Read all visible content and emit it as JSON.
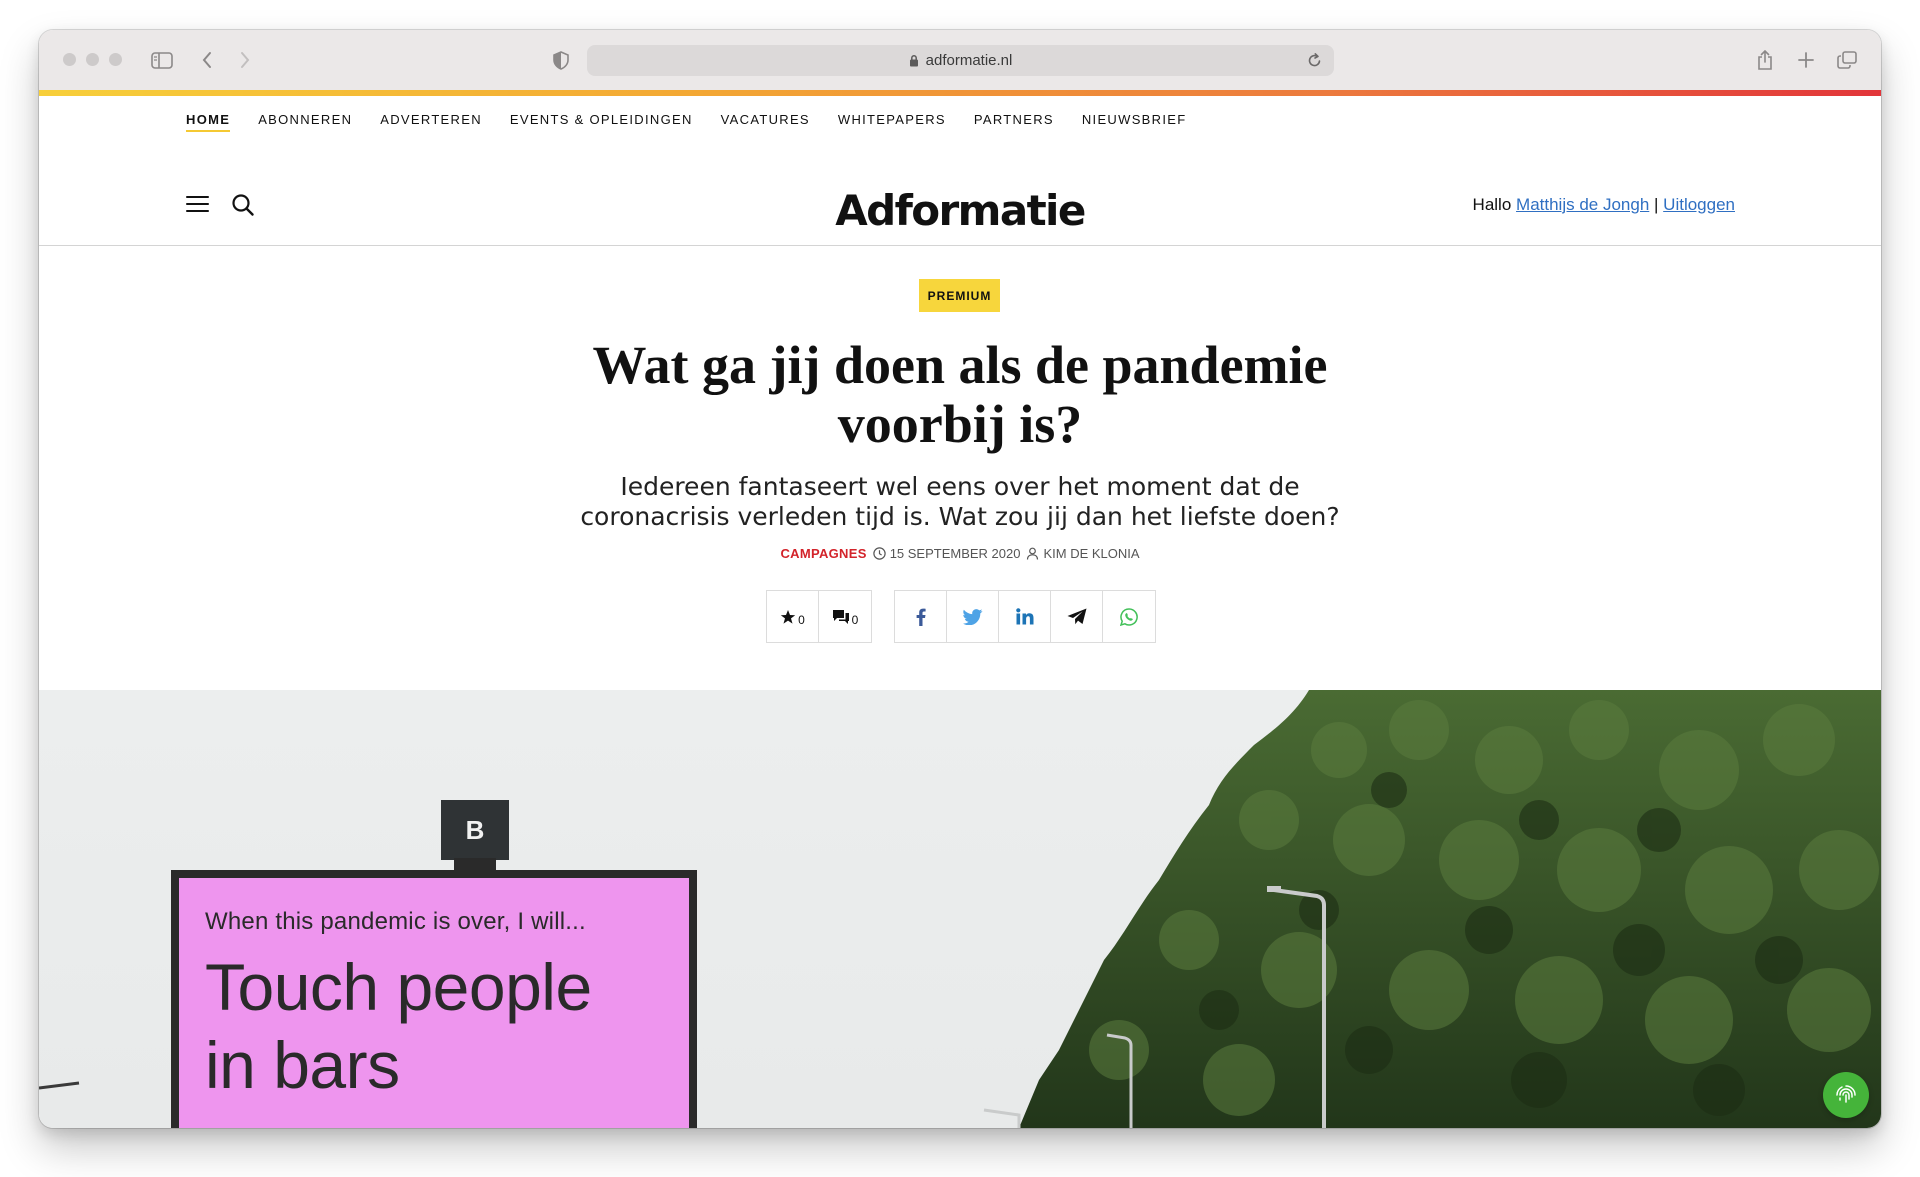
{
  "browser": {
    "url": "adformatie.nl"
  },
  "nav": {
    "items": [
      "HOME",
      "ABONNEREN",
      "ADVERTEREN",
      "EVENTS & OPLEIDINGEN",
      "VACATURES",
      "WHITEPAPERS",
      "PARTNERS",
      "NIEUWSBRIEF"
    ]
  },
  "header": {
    "logo": "Adformatie",
    "greeting": "Hallo",
    "user_name": "Matthijs de Jongh",
    "separator": "|",
    "logout": "Uitloggen"
  },
  "article": {
    "badge": "PREMIUM",
    "title_line1": "Wat ga jij doen als de pandemie",
    "title_line2": "voorbij is?",
    "intro_line1": "Iedereen fantaseert wel eens over het moment dat de",
    "intro_line2": "coronacrisis verleden tijd is. Wat zou jij dan het liefste doen?",
    "category": "CAMPAGNES",
    "date": "15 SEPTEMBER 2020",
    "author": "KIM DE KLONIA",
    "likes": "0",
    "comments": "0"
  },
  "hero": {
    "billboard_small": "When this pandemic is over, I will...",
    "billboard_line1": "Touch people",
    "billboard_line2": "in bars",
    "billboard_box": "B"
  },
  "colors": {
    "accent_yellow": "#f7d63c",
    "category_red": "#d3232a",
    "link_blue": "#2f6fc2",
    "billboard_pink": "#ee95ee"
  }
}
